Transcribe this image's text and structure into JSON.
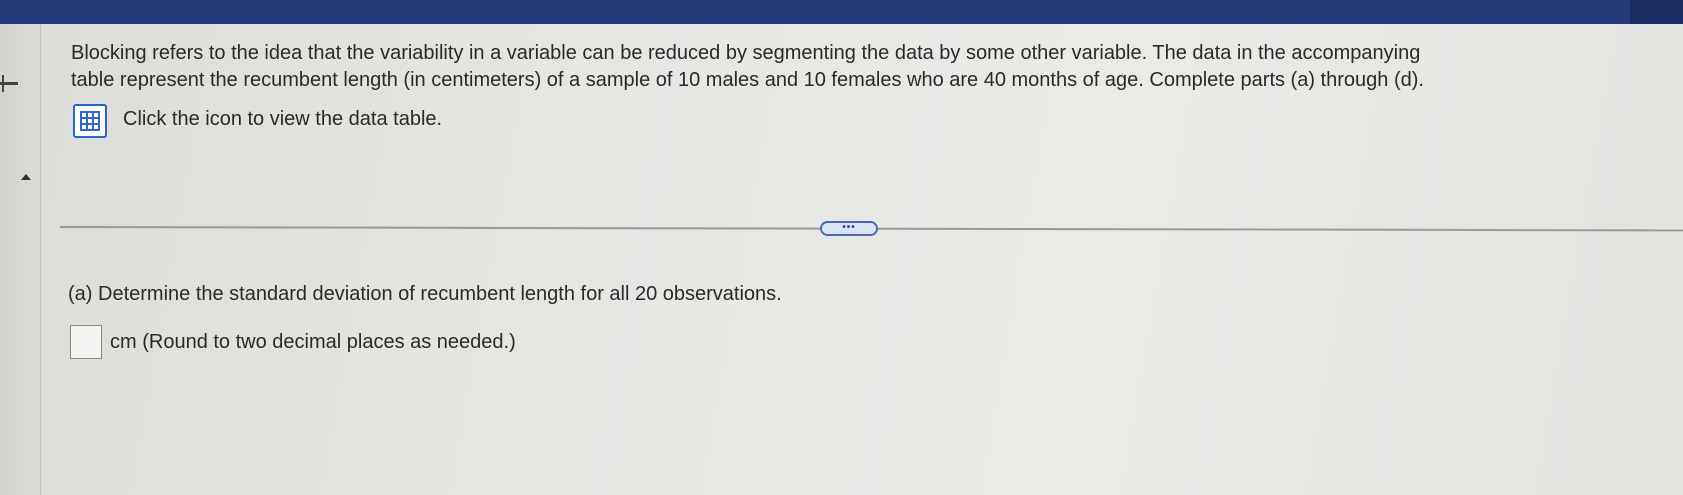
{
  "question": {
    "intro_line1": "Blocking refers to the idea that the variability in a variable can be reduced by segmenting the data by some other variable. The data in the accompanying",
    "intro_line2": "table represent the recumbent length (in centimeters) of a sample of 10 males and 10 females who are 40 months of age. Complete parts (a) through (d).",
    "data_link": "Click the icon to view the data table.",
    "data_icon": "data-table-icon"
  },
  "divider": {
    "expand_label": "•••"
  },
  "part_a": {
    "prompt": "(a) Determine the standard deviation of recumbent length for all 20 observations.",
    "answer_value": "",
    "unit_note": "cm (Round to two decimal places as needed.)"
  },
  "colors": {
    "header_bar": "#253a7a",
    "link_icon": "#2b64c9",
    "text": "#2a2a2a"
  }
}
